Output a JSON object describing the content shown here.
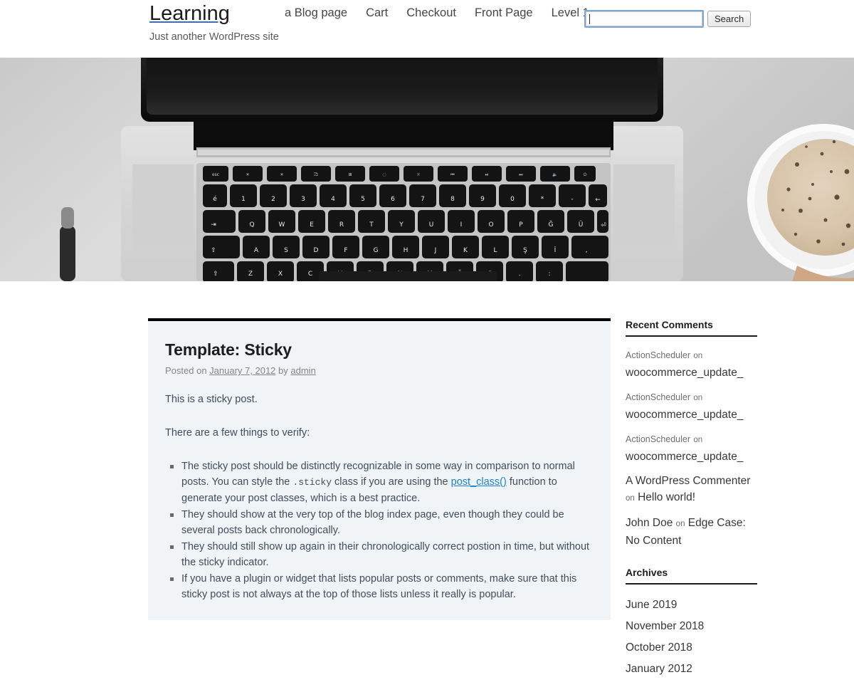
{
  "site": {
    "title": "Learning",
    "description": "Just another WordPress site"
  },
  "nav": {
    "items": [
      {
        "label": "a Blog page",
        "name": "nav-item-a-blog-page"
      },
      {
        "label": "Cart",
        "name": "nav-item-cart"
      },
      {
        "label": "Checkout",
        "name": "nav-item-checkout"
      },
      {
        "label": "Front Page",
        "name": "nav-item-front-page"
      },
      {
        "label": "Level 1",
        "name": "nav-item-level-1"
      }
    ]
  },
  "search": {
    "value": "",
    "placeholder": "",
    "button_label": "Search"
  },
  "post": {
    "title": "Template: Sticky",
    "meta_prefix": "Posted on",
    "date": "January 7, 2012",
    "meta_by": "by",
    "author": "admin",
    "paragraph_1": "This is a sticky post.",
    "paragraph_2": "There are a few things to verify:",
    "list": [
      {
        "part_1": "The sticky post should be distinctly recognizable in some way in comparison to normal posts. You can style the ",
        "code": ".sticky",
        "part_2": " class if you are using the ",
        "link": "post_class()",
        "part_3": " function to generate your post classes, which is a best practice."
      },
      {
        "part_1": "They should show at the very top of the blog index page, even though they could be several posts back chronologically.",
        "code": "",
        "part_2": "",
        "link": "",
        "part_3": ""
      },
      {
        "part_1": "They should still show up again in their chronologically correct postion in time, but without the sticky indicator.",
        "code": "",
        "part_2": "",
        "link": "",
        "part_3": ""
      },
      {
        "part_1": "If you have a plugin or widget that lists popular posts or comments, make sure that this sticky post is not always at the top of those lists unless it really is popular.",
        "code": "",
        "part_2": "",
        "link": "",
        "part_3": ""
      }
    ]
  },
  "sidebar": {
    "recent_comments": {
      "title": "Recent Comments",
      "items": [
        {
          "author": "ActionScheduler",
          "on": "on",
          "target": "woocommerce_update_",
          "author_small": true
        },
        {
          "author": "ActionScheduler",
          "on": "on",
          "target": "woocommerce_update_",
          "author_small": true
        },
        {
          "author": "ActionScheduler",
          "on": "on",
          "target": "woocommerce_update_",
          "author_small": true
        },
        {
          "author": "A WordPress Commenter",
          "on": "on",
          "target": "Hello world!",
          "author_small": false
        },
        {
          "author": "John Doe",
          "on": "on",
          "target": "Edge Case: No Content",
          "author_small": false
        }
      ]
    },
    "archives": {
      "title": "Archives",
      "items": [
        "June 2019",
        "November 2018",
        "October 2018",
        "January 2012"
      ]
    }
  },
  "colors": {
    "link_blue": "#1982d1",
    "sticky_bg": "#f0f4f7",
    "text": "#373737",
    "body_text": "#414d5c",
    "meta_gray": "#858585",
    "focus_border": "#7aa7d8"
  }
}
